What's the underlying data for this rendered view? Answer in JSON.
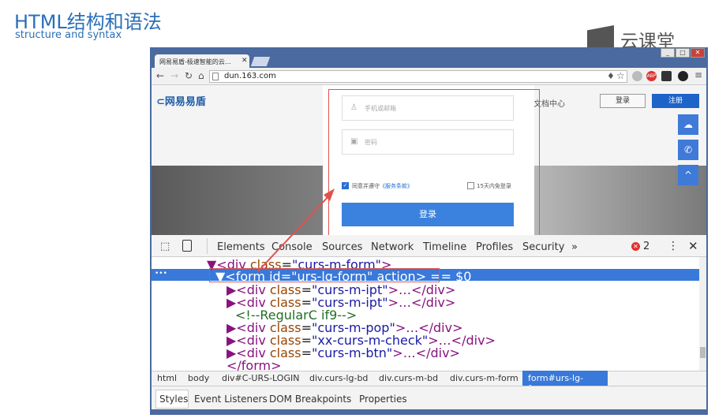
{
  "slide": {
    "title": "HTML结构和语法",
    "subtitle": "structure and syntax",
    "brand": "云课堂"
  },
  "browser": {
    "tab_title": "网易易盾-极速智能的云…",
    "url": "dun.163.com",
    "window_buttons": [
      "_",
      "□",
      "✕"
    ]
  },
  "site": {
    "logo": "网易易盾",
    "doc_center": "文档中心",
    "login_button": "登录",
    "register_button": "注册",
    "side_icons": [
      "chat-icon",
      "phone-icon",
      "up-icon"
    ]
  },
  "login_form": {
    "username_placeholder": "手机或邮箱",
    "password_placeholder": "密码",
    "agree_label": "同意并遵守",
    "agree_link": "《服务条款》",
    "remember_label": "15天内免登录",
    "submit_label": "登录"
  },
  "devtools": {
    "tabs": [
      "Elements",
      "Console",
      "Sources",
      "Network",
      "Timeline",
      "Profiles",
      "Security",
      "»"
    ],
    "error_count": "2",
    "code_lines": [
      {
        "tag": "▼<div ",
        "attr": "class",
        "val": "\"curs-m-form\"",
        "rest": ">"
      },
      {
        "tag": "▼<form ",
        "attr": "id",
        "val": "\"urs-lg-form\"",
        "rest": " action> == $0"
      },
      {
        "tag": "▶<div ",
        "attr": "class",
        "val": "\"curs-m-ipt\"",
        "rest": ">…</div>"
      },
      {
        "tag": "▶<div ",
        "attr": "class",
        "val": "\"curs-m-ipt\"",
        "rest": ">…</div>"
      },
      {
        "comment": "<!--RegularC if9-->"
      },
      {
        "tag": "▶<div ",
        "attr": "class",
        "val": "\"curs-m-pop\"",
        "rest": ">…</div>"
      },
      {
        "tag": "▶<div ",
        "attr": "class",
        "val": "\"xx-curs-m-check\"",
        "rest": ">…</div>"
      },
      {
        "tag": "▶<div ",
        "attr": "class",
        "val": "\"curs-m-btn\"",
        "rest": ">…</div>"
      },
      {
        "tag": "</form>",
        "attr": "",
        "val": "",
        "rest": ""
      }
    ],
    "breadcrumbs": [
      "html",
      "body",
      "div#C-URS-LOGIN",
      "div.curs-lg-bd",
      "div.curs-m-bd",
      "div.curs-m-form",
      "form#urs-lg-form"
    ],
    "subtabs": [
      "Styles",
      "Event Listeners",
      "DOM Breakpoints",
      "Properties"
    ]
  },
  "colors": {
    "accent": "#3879d9",
    "highlight": "#e0524c",
    "title": "#2a6fb8"
  }
}
